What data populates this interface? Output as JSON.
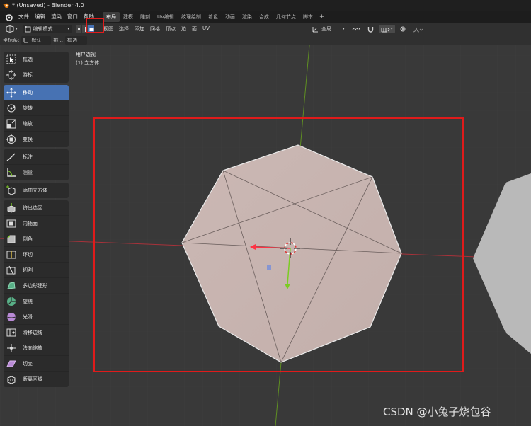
{
  "title_bar": {
    "text": "* (Unsaved) - Blender 4.0"
  },
  "menubar": {
    "items": [
      "文件",
      "编辑",
      "渲染",
      "窗口",
      "帮助"
    ],
    "workspaces": [
      "布局",
      "建模",
      "雕刻",
      "UV编辑",
      "纹理绘制",
      "着色",
      "动画",
      "渲染",
      "合成",
      "几何节点",
      "脚本"
    ],
    "active_workspace": "布局",
    "add_symbol": "+"
  },
  "header": {
    "mode": "编辑模式",
    "menus": [
      "视图",
      "选择",
      "添加",
      "网格",
      "顶点",
      "边",
      "面",
      "UV"
    ],
    "transform_orientation": "全局",
    "selection_mode_active": "face"
  },
  "tool_settings": {
    "coord_label": "坐标系:",
    "coord_value": "默认",
    "drag_label": "拖...",
    "drag_value": "框选"
  },
  "viewport": {
    "perspective_label": "用户透视",
    "object_label": "(1) 立方体"
  },
  "toolbar": {
    "groups": [
      [
        "框选",
        "游标"
      ],
      [
        "移动",
        "旋转",
        "缩放",
        "变换"
      ],
      [
        "标注",
        "测量"
      ],
      [
        "添加立方体"
      ],
      [
        "挤出选区",
        "内插面",
        "倒角",
        "环切",
        "切割",
        "多边形建形",
        "旋绕",
        "光滑",
        "滑移边线",
        "法向缩放",
        "切变",
        "断离区域"
      ]
    ],
    "active_tool": "移动"
  },
  "watermark": "CSDN @小兔子烧包谷",
  "colors": {
    "accent": "#4772b3",
    "highlight_box": "#e01b1b",
    "mesh_face": "#c9b6b2",
    "x_axis": "#c8353f",
    "y_axis": "#6b9a2a"
  }
}
